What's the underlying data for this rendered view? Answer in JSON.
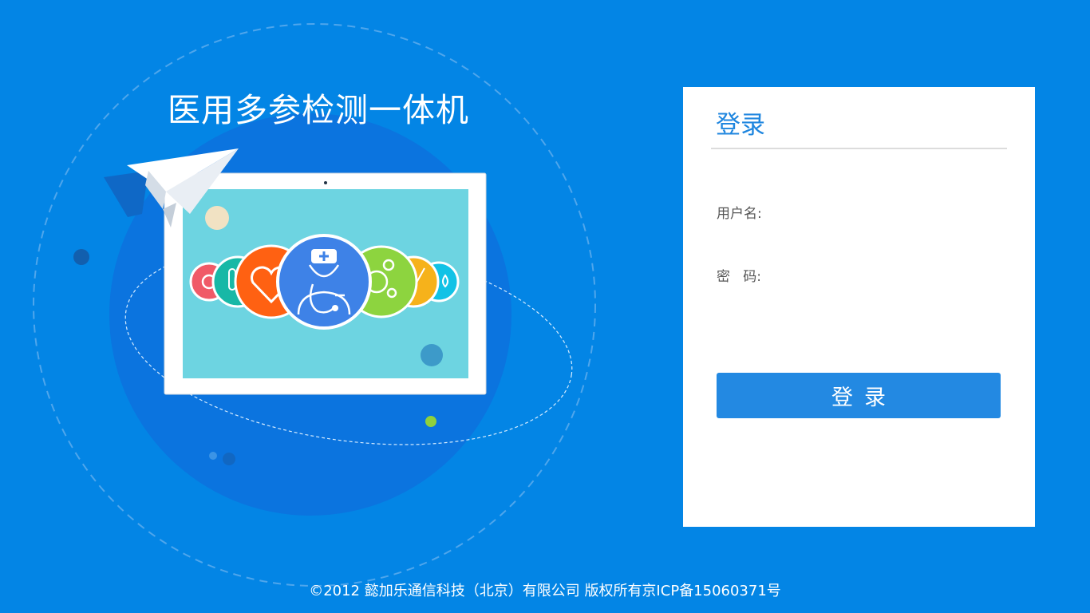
{
  "app": {
    "title": "医用多参检测一体机"
  },
  "login": {
    "heading": "登录",
    "username_label": "用户名:",
    "password_label": "密   码:",
    "username_value": "",
    "password_value": "",
    "submit_label": "登录"
  },
  "footer": {
    "copyright": "©2012 懿加乐通信科技（北京）有限公司 版权所有京ICP备15060371号"
  },
  "colors": {
    "background": "#0385e5",
    "panel": "#ffffff",
    "accent": "#2389e2",
    "heading": "#1f86df",
    "label": "#555555"
  },
  "icons": [
    "paper-plane-icon",
    "tablet-illustration",
    "gear-badge-icon",
    "test-tube-badge-icon",
    "heart-badge-icon",
    "doctor-badge-icon",
    "bubbles-badge-icon",
    "feather-badge-icon",
    "drop-badge-icon"
  ]
}
